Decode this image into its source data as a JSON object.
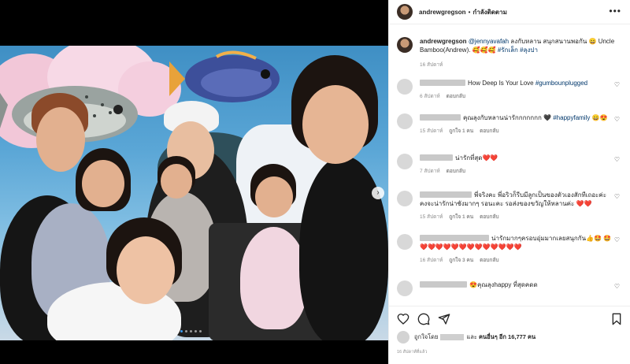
{
  "post": {
    "username": "andrewgregson",
    "separator": "•",
    "follow_status": "กำลังติดตาม",
    "more_label": "•••"
  },
  "caption": {
    "username": "andrewgregson",
    "mention": "@jennyavafah",
    "text": " ลงกับหลาน สนุกสนานพอกัน 😄 Uncle Bamboo(Andrew). 🥰🥰🥰 ",
    "tags": "#รักเล็ก #ลุงปา",
    "time": "16 สัปดาห์"
  },
  "comments": [
    {
      "text": "How Deep Is Your Love ",
      "tag": "#gumbounplugged",
      "time": "6 สัปดาห์",
      "likes": "",
      "reply": "ตอบกลับ"
    },
    {
      "text": "คุณลุงกับหลานน่ารักกกกกกก 🖤 ",
      "tag": "#happyfamily",
      "tail": " 😄😍",
      "time": "15 สัปดาห์",
      "likes": "ถูกใจ 1 คน",
      "reply": "ตอบกลับ"
    },
    {
      "text": "น่ารักที่สุด❤️❤️",
      "time": "7 สัปดาห์",
      "likes": "",
      "reply": "ตอบกลับ"
    },
    {
      "text": "พี่จริงคะ พี่อริวก็รีบมีลูกเป็นของตัวเองสักทีเถอะค่ะ คงจะน่ารักน่าชังมากๆ รอนะคะ รอส่งของขวัญให้หลานค่ะ ❤️❤️",
      "time": "15 สัปดาห์",
      "likes": "ถูกใจ 1 คน",
      "reply": "ตอบกลับ"
    },
    {
      "text": "น่ารักมากๆครอบอุ่มมากเลยสนุกกัน👍🤩 🤩❤️❤️❤️❤️❤️❤️❤️❤️❤️❤️❤️❤️❤️",
      "time": "16 สัปดาห์",
      "likes": "ถูกใจ 3 คน",
      "reply": "ตอบกลับ"
    },
    {
      "text": "😍คุณลุงhappy ที่สุดคดด",
      "time": "",
      "likes": "",
      "reply": ""
    }
  ],
  "likes": {
    "prefix": "ถูกใจโดย",
    "middle": "และ",
    "others": "คนอื่นๆ อีก 16,777 คน"
  },
  "posted_ago": "16 สัปดาห์ที่แล้ว",
  "colors": {
    "link": "#00376b",
    "text": "#262626",
    "muted": "#8e8e8e"
  }
}
